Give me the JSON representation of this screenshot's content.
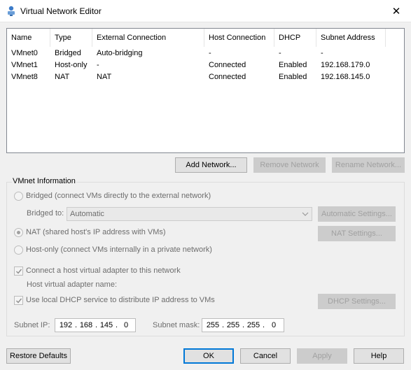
{
  "window": {
    "title": "Virtual Network Editor",
    "close_glyph": "✕"
  },
  "network_table": {
    "columns": [
      "Name",
      "Type",
      "External Connection",
      "Host Connection",
      "DHCP",
      "Subnet Address"
    ],
    "rows": [
      {
        "name": "VMnet0",
        "type": "Bridged",
        "external": "Auto-bridging",
        "host": "-",
        "dhcp": "-",
        "subnet": "-"
      },
      {
        "name": "VMnet1",
        "type": "Host-only",
        "external": "-",
        "host": "Connected",
        "dhcp": "Enabled",
        "subnet": "192.168.179.0"
      },
      {
        "name": "VMnet8",
        "type": "NAT",
        "external": "NAT",
        "host": "Connected",
        "dhcp": "Enabled",
        "subnet": "192.168.145.0"
      }
    ]
  },
  "network_buttons": {
    "add": "Add Network...",
    "remove": "Remove Network",
    "rename": "Rename Network..."
  },
  "vmnet_info": {
    "title": "VMnet Information",
    "bridged_label": "Bridged (connect VMs directly to the external network)",
    "bridged_to_label": "Bridged to:",
    "bridged_to_value": "Automatic",
    "auto_settings": "Automatic Settings...",
    "nat_label": "NAT (shared host's IP address with VMs)",
    "nat_settings": "NAT Settings...",
    "hostonly_label": "Host-only (connect VMs internally in a private network)",
    "connect_adapter_label": "Connect a host virtual adapter to this network",
    "adapter_name_label": "Host virtual adapter name:",
    "dhcp_label": "Use local DHCP service to distribute IP address to VMs",
    "dhcp_settings": "DHCP Settings...",
    "selected_mode": "NAT",
    "connect_adapter_checked": true,
    "dhcp_checked": true,
    "subnet_ip_label": "Subnet IP:",
    "subnet_ip": [
      "192",
      "168",
      "145",
      "0"
    ],
    "subnet_mask_label": "Subnet mask:",
    "subnet_mask": [
      "255",
      "255",
      "255",
      "0"
    ]
  },
  "footer": {
    "restore": "Restore Defaults",
    "ok": "OK",
    "cancel": "Cancel",
    "apply": "Apply",
    "help": "Help"
  },
  "colors": {
    "accent": "#0078d7",
    "disabled_text": "#a0a0a0",
    "window_bg": "#f0f0f0"
  }
}
